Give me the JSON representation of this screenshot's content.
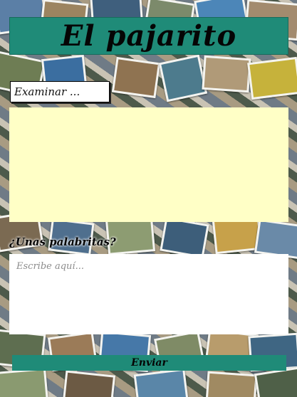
{
  "header": {
    "title": "El pajarito"
  },
  "upload": {
    "browse_label": "Examinar ..."
  },
  "message": {
    "prompt": "¿Unas palabritas?",
    "placeholder": "Escribe aquí..."
  },
  "actions": {
    "send_label": "Enviar"
  },
  "colors": {
    "accent": "#1f8b78",
    "preview_background": "#ffffc6",
    "input_background": "#ffffff"
  }
}
